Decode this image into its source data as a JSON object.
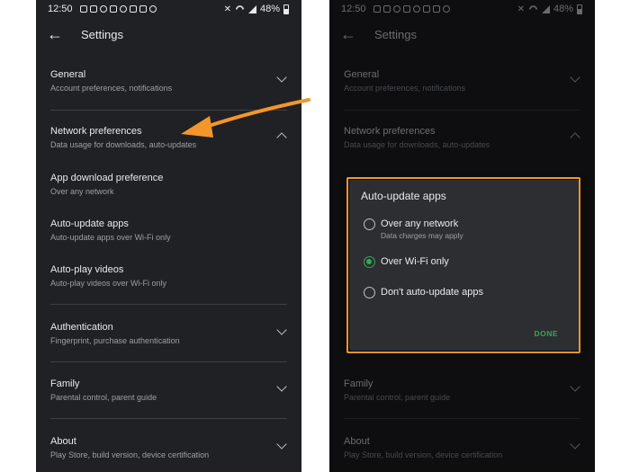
{
  "status": {
    "time": "12:50",
    "battery": "48%"
  },
  "appbar": {
    "title": "Settings"
  },
  "settings": {
    "general": {
      "title": "General",
      "subtitle": "Account preferences, notifications"
    },
    "network": {
      "title": "Network preferences",
      "subtitle": "Data usage for downloads, auto-updates"
    },
    "app_download": {
      "title": "App download preference",
      "subtitle": "Over any network"
    },
    "auto_update": {
      "title": "Auto-update apps",
      "subtitle": "Auto-update apps over Wi-Fi only"
    },
    "auto_play": {
      "title": "Auto-play videos",
      "subtitle": "Auto-play videos over Wi-Fi only"
    },
    "authentication": {
      "title": "Authentication",
      "subtitle": "Fingerprint, purchase authentication"
    },
    "family": {
      "title": "Family",
      "subtitle": "Parental control, parent guide"
    },
    "about": {
      "title": "About",
      "subtitle": "Play Store, build version, device certification"
    }
  },
  "dialog": {
    "title": "Auto-update apps",
    "options": [
      {
        "label": "Over any network",
        "sublabel": "Data charges may apply",
        "selected": false
      },
      {
        "label": "Over Wi-Fi only",
        "sublabel": "",
        "selected": true
      },
      {
        "label": "Don't auto-update apps",
        "sublabel": "",
        "selected": false
      }
    ],
    "done_label": "DONE"
  },
  "colors": {
    "accent": "#34a853",
    "highlight": "#f4962a",
    "background": "#202124"
  }
}
